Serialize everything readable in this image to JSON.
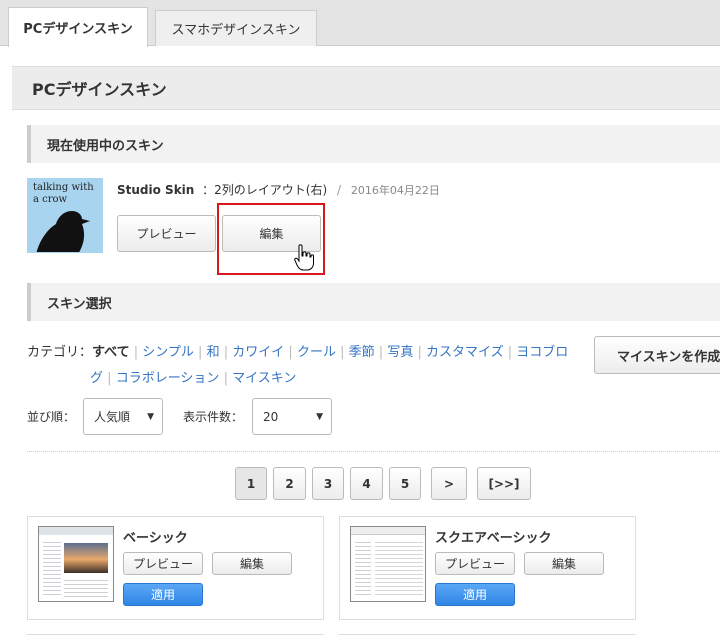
{
  "tabs": {
    "pc": "PCデザインスキン",
    "smartphone": "スマホデザインスキン"
  },
  "page_title": "PCデザインスキン",
  "current": {
    "section_title": "現在使用中のスキン",
    "thumb_text": "talking with a crow",
    "skin_name": "Studio Skin",
    "layout": "：2列のレイアウト(右)",
    "divider": "/",
    "date": "2016年04月22日",
    "preview_label": "プレビュー",
    "edit_label": "編集"
  },
  "select_section": {
    "title": "スキン選択",
    "category_label": "カテゴリ：",
    "categories_row1": [
      "すべて",
      "シンプル",
      "和",
      "カワイイ",
      "クール",
      "季節",
      "写真",
      "カスタマイズ",
      "ヨコブロ"
    ],
    "categories_row2": [
      "グ",
      "コラボレーション",
      "マイスキン"
    ],
    "create_button": "マイスキンを作成",
    "sort_label": "並び順：",
    "sort_value": "人気順",
    "count_label": "表示件数：",
    "count_value": "20"
  },
  "pagination": [
    "1",
    "2",
    "3",
    "4",
    "5",
    ">",
    "[>>]"
  ],
  "skins": [
    {
      "name": "ベーシック",
      "preview_label": "プレビュー",
      "edit_label": "編集",
      "apply_label": "適用"
    },
    {
      "name": "スクエアベーシック",
      "preview_label": "プレビュー",
      "edit_label": "編集",
      "apply_label": "適用"
    }
  ],
  "colors": {
    "accent_link": "#3574c4",
    "highlight_border": "#d9181e",
    "apply_blue": "#2f86e6",
    "thumb_sky": "#a9d4f0"
  },
  "icons": {
    "cursor": "hand-pointer-icon"
  }
}
